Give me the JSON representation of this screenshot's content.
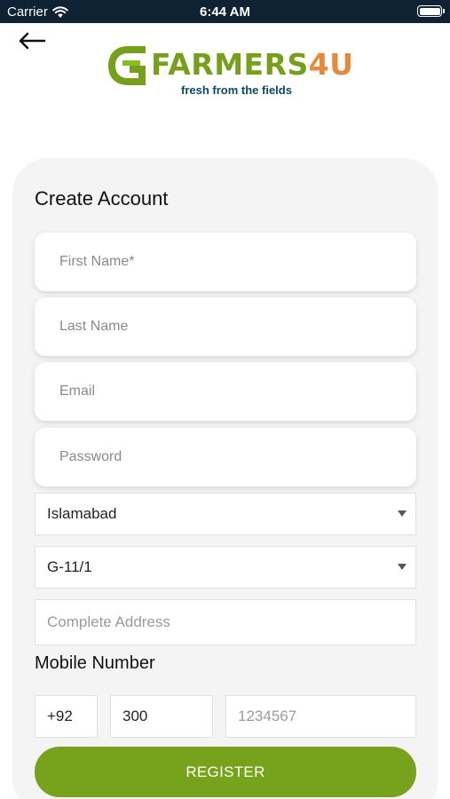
{
  "status_bar": {
    "carrier": "Carrier",
    "time": "6:44 AM"
  },
  "logo": {
    "brand_part1": "FARMERS",
    "brand_part2": "4U",
    "tagline": "fresh from the fields"
  },
  "form": {
    "title": "Create Account",
    "first_name_placeholder": "First Name*",
    "last_name_placeholder": "Last Name",
    "email_placeholder": "Email",
    "password_placeholder": "Password",
    "city_value": "Islamabad",
    "sector_value": "G-11/1",
    "address_placeholder": "Complete Address",
    "mobile_label": "Mobile Number",
    "country_code_value": "+92",
    "operator_code_value": "300",
    "phone_placeholder": "1234567",
    "register_label": "REGISTER"
  },
  "colors": {
    "accent_green": "#76a31b",
    "brand_orange": "#e8893a",
    "status_bar_bg": "#0e2233"
  }
}
